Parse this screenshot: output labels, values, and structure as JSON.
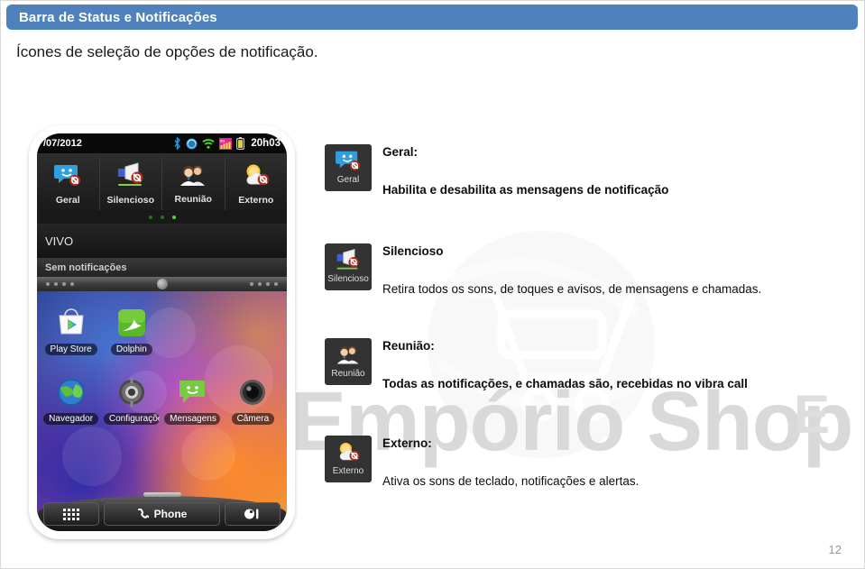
{
  "header": {
    "title": "Barra de Status e Notificações",
    "bar_color": "#4F81BD"
  },
  "caption": "Ícones de seleção de opções de notificação.",
  "watermark": {
    "text": "Empório Shop",
    "small_text": "E",
    "logo": "shopping-cart-logo"
  },
  "phone": {
    "status_bar": {
      "date": "/07/2012",
      "time": "20h03",
      "icons": [
        "bluetooth-icon",
        "sync-icon",
        "wifi-icon",
        "signal-3g-icon",
        "battery-icon"
      ]
    },
    "quick_settings": [
      {
        "label": "Geral",
        "icon": "message-bubble-disabled-icon"
      },
      {
        "label": "Silencioso",
        "icon": "megaphone-disabled-icon"
      },
      {
        "label": "Reunião",
        "icon": "people-icon"
      },
      {
        "label": "Externo",
        "icon": "sun-cloud-disabled-icon"
      }
    ],
    "page_dots": {
      "count": 3,
      "active_index": 2
    },
    "carrier": "VIVO",
    "notifications_empty": "Sem notificações",
    "home_apps": [
      {
        "label": "Play Store",
        "icon": "play-store-icon"
      },
      {
        "label": "Dolphin",
        "icon": "dolphin-browser-icon"
      },
      {
        "label": "Navegador",
        "icon": "globe-browser-icon"
      },
      {
        "label": "Configurações",
        "icon": "settings-gear-icon"
      },
      {
        "label": "Mensagens",
        "icon": "sms-bubble-icon"
      },
      {
        "label": "Câmera",
        "icon": "camera-lens-icon"
      }
    ],
    "dock": [
      {
        "label": "",
        "icon": "app-drawer-icon"
      },
      {
        "label": "Phone",
        "icon": "phone-handset-icon"
      },
      {
        "label": "",
        "icon": "contacts-icon"
      }
    ]
  },
  "descriptions": [
    {
      "thumb_label": "Geral",
      "icon": "message-bubble-disabled-icon",
      "title": "Geral:",
      "body": "Habilita e desabilita as mensagens de notificação",
      "body_bold": true
    },
    {
      "thumb_label": "Silencioso",
      "icon": "megaphone-disabled-icon",
      "title": "Silencioso",
      "body": "Retira todos os sons, de toques e avisos, de mensagens e chamadas.",
      "body_bold": false
    },
    {
      "thumb_label": "Reunião",
      "icon": "people-icon",
      "title": "Reunião:",
      "body": "Todas as notificações, e chamadas são, recebidas no vibra call",
      "body_bold": true
    },
    {
      "thumb_label": "Externo",
      "icon": "sun-cloud-disabled-icon",
      "title": "Externo:",
      "body": "Ativa os sons de teclado, notificações e alertas.",
      "body_bold": false
    }
  ],
  "page_number": "12"
}
